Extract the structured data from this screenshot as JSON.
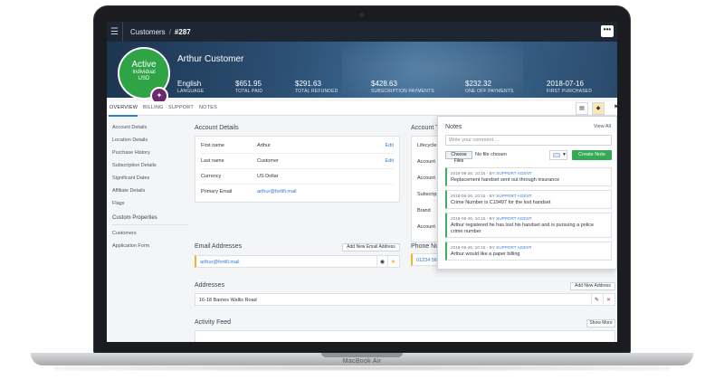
{
  "device": {
    "label": "MacBook Air"
  },
  "topbar": {
    "crumb_root": "Customers",
    "crumb_sep": "/",
    "crumb_id": "#287",
    "more": "•••"
  },
  "hero": {
    "status": "Active",
    "status_lines": [
      "Individual",
      "USD"
    ],
    "name": "Arthur Customer",
    "stats": [
      {
        "value": "English",
        "label": "LANGUAGE"
      },
      {
        "value": "$651.95",
        "label": "TOTAL PAID"
      },
      {
        "value": "$291.63",
        "label": "TOTAL REFUNDED"
      },
      {
        "value": "$428.63",
        "label": "SUBSCRIPTION PAYMENTS"
      },
      {
        "value": "$232.32",
        "label": "ONE OFF PAYMENTS"
      },
      {
        "value": "2018-07-16",
        "label": "FIRST PURCHASED"
      }
    ]
  },
  "tabs": [
    "OVERVIEW",
    "BILLING",
    "SUPPORT",
    "NOTES"
  ],
  "sidebar": {
    "items": [
      "Account Details",
      "Location Details",
      "Purchase History",
      "Subscription Details",
      "Significant Dates",
      "Affiliate Details",
      "Flags"
    ],
    "custom_heading": "Custom Properties",
    "custom_items": [
      "Customers",
      "Application Form"
    ]
  },
  "account_details": {
    "title": "Account Details",
    "rows": [
      {
        "label": "First name",
        "value": "Arthur",
        "edit": "Edit"
      },
      {
        "label": "Last name",
        "value": "Customer",
        "edit": "Edit"
      },
      {
        "label": "Currency",
        "value": "US Dollar"
      },
      {
        "label": "Primary Email",
        "value": "arthur@fortifi.mail"
      }
    ]
  },
  "account_right": {
    "title": "Account T",
    "labels": [
      "Lifecycle",
      "Account",
      "Account",
      "Subscrip",
      "Brand",
      "Account"
    ]
  },
  "emails": {
    "title": "Email Addresses",
    "add_label": "Add New Email Address",
    "value": "arthur@fortifi.mail"
  },
  "phones": {
    "title": "Phone Nu",
    "value": "01234 56"
  },
  "addresses": {
    "title": "Addresses",
    "add_label": "Add New Address",
    "value": "16-18 Barnes Wallis Road"
  },
  "activity": {
    "title": "Activity Feed",
    "show_more": "Show More"
  },
  "notes": {
    "title": "Notes",
    "view_all": "View All",
    "placeholder": "Write your comment ...",
    "choose_files": "Choose Files",
    "no_file": "No file chosen",
    "create": "Create Note",
    "items": [
      {
        "date": "2018-06-26, 10:15 - BY ",
        "agent": "SUPPORT AGENT",
        "text": "Replacement handset sent out through insurance"
      },
      {
        "date": "2018-06-26, 10:15 - BY ",
        "agent": "SUPPORT AGENT",
        "text": "Crime Number is C19497 for the lost handset"
      },
      {
        "date": "2018-06-26, 10:15 - BY ",
        "agent": "SUPPORT AGENT",
        "text": "Arthur registered he has lost his handset and is pursuing a police crime number"
      },
      {
        "date": "2018-06-26, 10:15 - BY ",
        "agent": "SUPPORT AGENT",
        "text": "Arthur would like a paper billing"
      }
    ]
  },
  "icons": {
    "menu": "menu-icon",
    "eye": "eye-icon",
    "star": "star-icon",
    "edit": "pencil-icon",
    "delete": "close-icon"
  },
  "colors": {
    "accent": "#2e7bd6",
    "active_badge": "#2ea446",
    "create_button": "#33aa55",
    "primary_marker": "#f0b429",
    "topbar": "#1e2633"
  }
}
